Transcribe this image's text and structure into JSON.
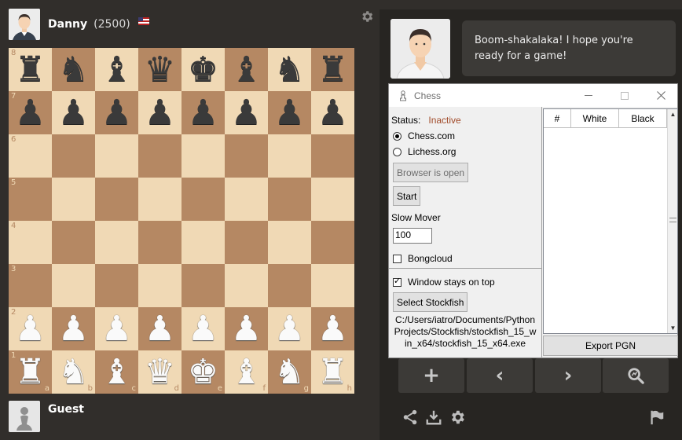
{
  "top_player": {
    "name": "Danny",
    "rating": "(2500)",
    "flag": "us-flag"
  },
  "bottom_player": {
    "name": "Guest"
  },
  "coach": {
    "message": "Boom-shakalaka! I hope you're ready for a game!"
  },
  "board": {
    "ranks": [
      "8",
      "7",
      "6",
      "5",
      "4",
      "3",
      "2",
      "1"
    ],
    "files": [
      "a",
      "b",
      "c",
      "d",
      "e",
      "f",
      "g",
      "h"
    ],
    "rows": [
      [
        "bR",
        "bN",
        "bB",
        "bQ",
        "bK",
        "bB",
        "bN",
        "bR"
      ],
      [
        "bP",
        "bP",
        "bP",
        "bP",
        "bP",
        "bP",
        "bP",
        "bP"
      ],
      [
        "",
        "",
        "",
        "",
        "",
        "",
        "",
        ""
      ],
      [
        "",
        "",
        "",
        "",
        "",
        "",
        "",
        ""
      ],
      [
        "",
        "",
        "",
        "",
        "",
        "",
        "",
        ""
      ],
      [
        "",
        "",
        "",
        "",
        "",
        "",
        "",
        ""
      ],
      [
        "wP",
        "wP",
        "wP",
        "wP",
        "wP",
        "wP",
        "wP",
        "wP"
      ],
      [
        "wR",
        "wN",
        "wB",
        "wQ",
        "wK",
        "wB",
        "wN",
        "wR"
      ]
    ]
  },
  "colors": {
    "light_square": "#f0d9b5",
    "dark_square": "#b58863",
    "status_inactive": "#a14b2a",
    "bg": "#312e2b"
  },
  "nav_buttons": [
    {
      "icon": "plus-icon",
      "glyph": "+"
    },
    {
      "icon": "chevron-left-icon",
      "glyph": "‹"
    },
    {
      "icon": "chevron-right-icon",
      "glyph": "›"
    },
    {
      "icon": "analysis-magnifier-icon",
      "glyph": ""
    }
  ],
  "tk_window": {
    "title": "Chess",
    "status_label": "Status:",
    "status_value": "Inactive",
    "site_options": [
      "Chess.com",
      "Lichess.org"
    ],
    "selected_site": "Chess.com",
    "browser_button": "Browser is open",
    "start_button": "Start",
    "slow_mover_label": "Slow Mover",
    "slow_mover_value": "100",
    "bongcloud_label": "Bongcloud",
    "bongcloud_checked": false,
    "on_top_label": "Window stays on top",
    "on_top_checked": true,
    "select_stockfish_button": "Select Stockfish",
    "stockfish_path": "C:/Users/iatro/Documents/PythonProjects/Stockfish/stockfish_15_win_x64/stockfish_15_x64.exe",
    "table_headers": [
      "#",
      "White",
      "Black"
    ],
    "export_button": "Export PGN"
  }
}
